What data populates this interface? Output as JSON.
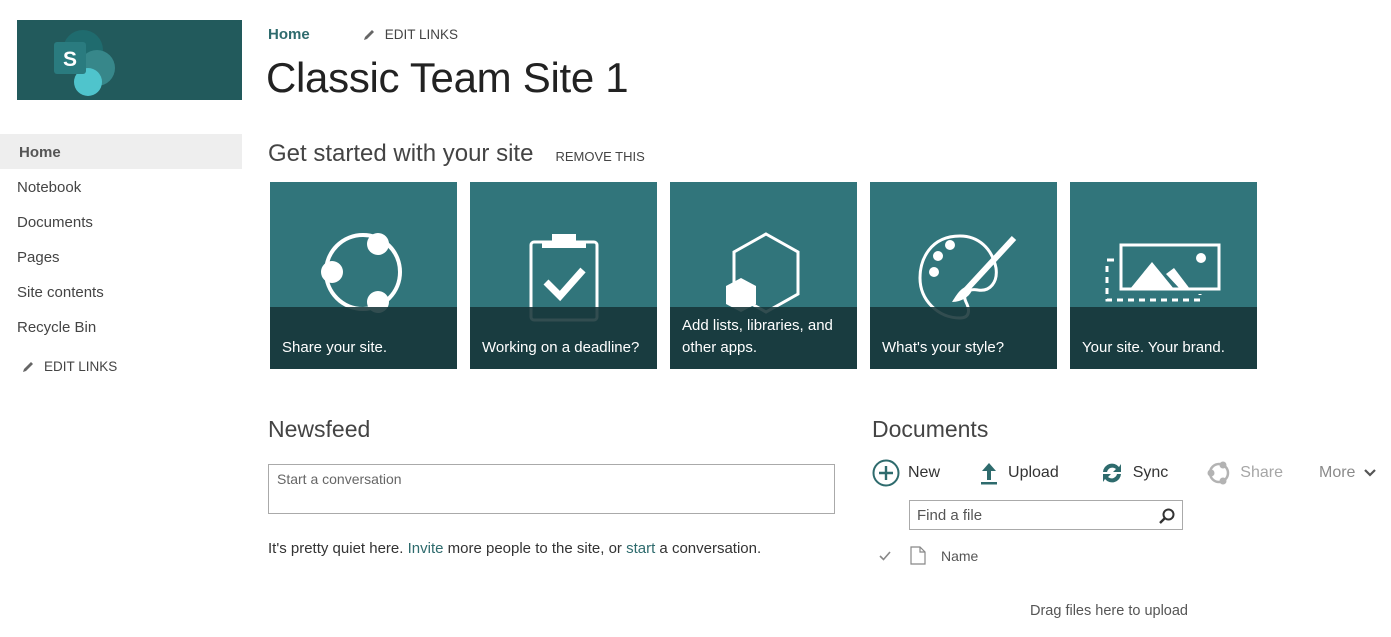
{
  "site": {
    "title": "Classic Team Site 1",
    "logo_letter": "S"
  },
  "breadcrumb": {
    "home": "Home",
    "edit_links": "EDIT LINKS"
  },
  "sidebar": {
    "items": [
      {
        "label": "Home",
        "active": true
      },
      {
        "label": "Notebook"
      },
      {
        "label": "Documents"
      },
      {
        "label": "Pages"
      },
      {
        "label": "Site contents"
      },
      {
        "label": "Recycle Bin"
      }
    ],
    "edit_links": "EDIT LINKS"
  },
  "get_started": {
    "title": "Get started with your site",
    "remove": "REMOVE THIS",
    "tiles": [
      {
        "label": "Share your site.",
        "icon": "share-icon"
      },
      {
        "label": "Working on a deadline?",
        "icon": "clipboard-check-icon"
      },
      {
        "label": "Add lists, libraries, and other apps.",
        "icon": "apps-hexagon-icon"
      },
      {
        "label": "What's your style?",
        "icon": "palette-icon"
      },
      {
        "label": "Your site. Your brand.",
        "icon": "brand-image-icon"
      }
    ]
  },
  "newsfeed": {
    "title": "Newsfeed",
    "input_placeholder": "Start a conversation",
    "message_prefix": "It's pretty quiet here. ",
    "invite_link": "Invite",
    "message_middle": " more people to the site, or ",
    "start_link": "start",
    "message_suffix": " a conversation."
  },
  "documents": {
    "title": "Documents",
    "toolbar": {
      "new": "New",
      "upload": "Upload",
      "sync": "Sync",
      "share": "Share",
      "more": "More"
    },
    "search_placeholder": "Find a file",
    "columns": {
      "name": "Name"
    },
    "empty_message": "Drag files here to upload"
  },
  "colors": {
    "brand_dark": "#225a5c",
    "tile": "#31757b",
    "tile_band": "#1c3a3d",
    "link": "#2e6b6d"
  }
}
